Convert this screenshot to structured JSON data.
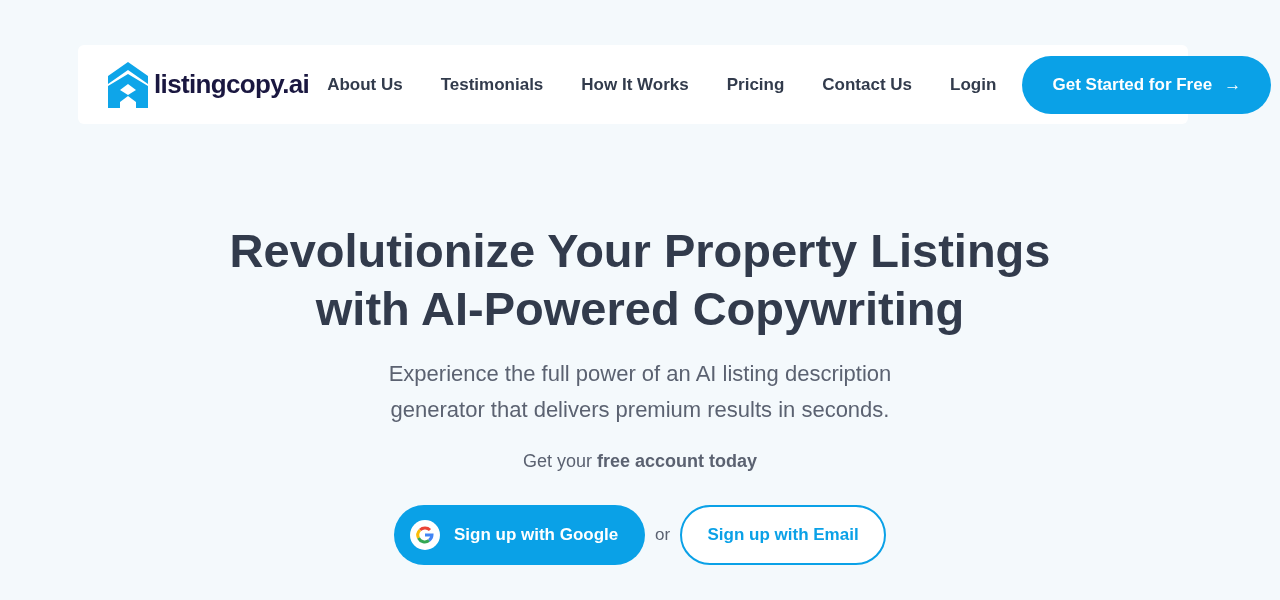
{
  "logo": {
    "text": "listingcopy.ai"
  },
  "nav": {
    "links": [
      "About Us",
      "Testimonials",
      "How It Works",
      "Pricing",
      "Contact Us",
      "Login"
    ],
    "cta": "Get Started for Free",
    "cta_icon": "→"
  },
  "hero": {
    "title_lines": [
      "Revolutionize Your Property Listings",
      "with AI-Powered Copywriting"
    ],
    "subtitle_lines": [
      "Experience the full power of an AI listing description",
      "generator that delivers premium results in seconds."
    ],
    "account_note": "Get your **free account today**",
    "google_button": "Sign up with Google",
    "separator": "or",
    "email_button": "Sign up with Email"
  }
}
